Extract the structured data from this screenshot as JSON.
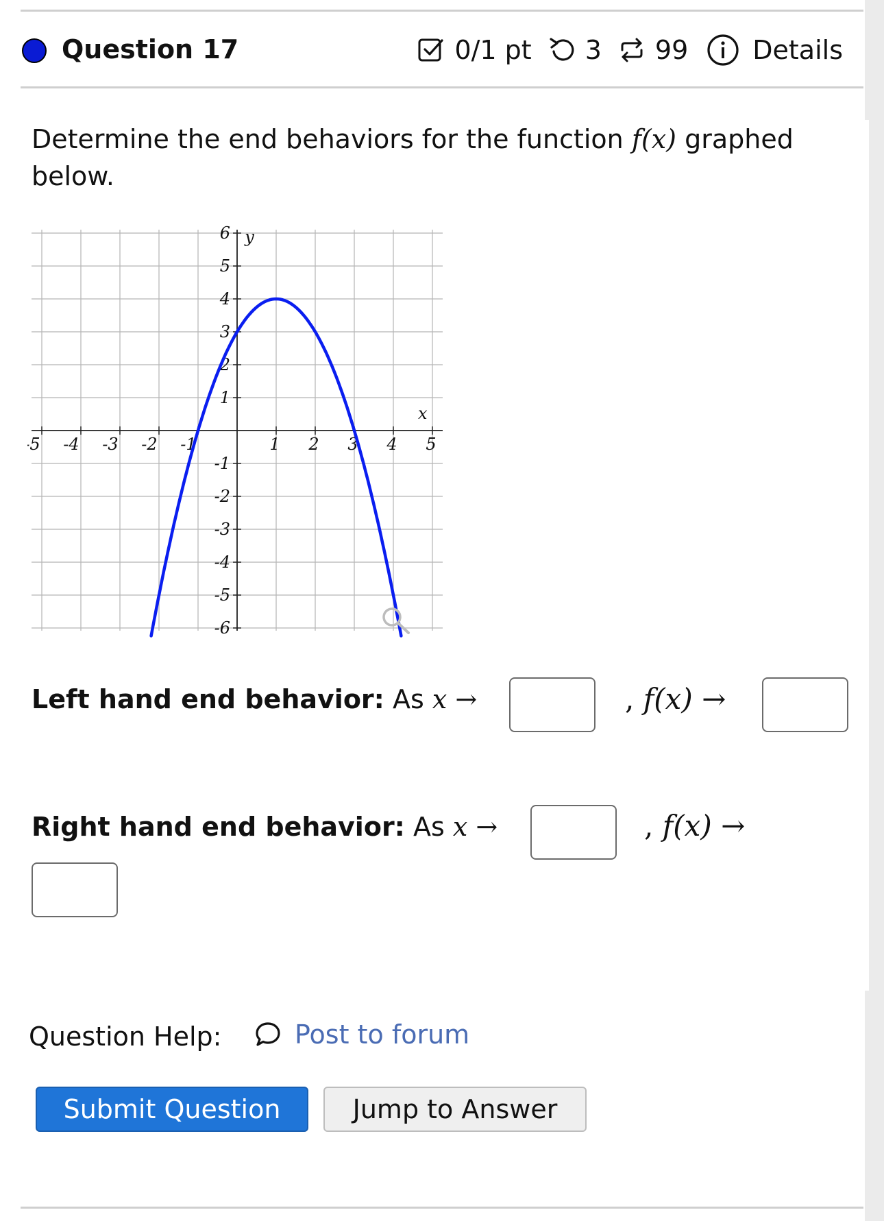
{
  "question": {
    "title": "Question 17",
    "score": "0/1 pt",
    "attempts": "3",
    "tries": "99",
    "details_label": "Details"
  },
  "prompt": {
    "text_before": "Determine the end behaviors for the function ",
    "func": "f(x)",
    "text_after": " graphed below."
  },
  "graph": {
    "x_axis_label": "x",
    "y_axis_label": "y",
    "x_ticks": [
      "-5",
      "-4",
      "-3",
      "-2",
      "-1",
      "1",
      "2",
      "3",
      "4",
      "5"
    ],
    "y_ticks": [
      "6",
      "5",
      "4",
      "3",
      "2",
      "1",
      "-1",
      "-2",
      "-3",
      "-4",
      "-5",
      "-6"
    ],
    "curve_color": "#0a1ef0",
    "magnify_icon": "magnifier-icon"
  },
  "chart_data": {
    "type": "line",
    "xlim": [
      -5,
      5
    ],
    "ylim": [
      -6,
      6
    ],
    "grid": true,
    "series": [
      {
        "x": [
          -2.2,
          -2.0,
          -1.5,
          -1.0,
          -0.5,
          0.0,
          0.5,
          1.0,
          1.5,
          2.0,
          2.5,
          3.0,
          3.5,
          4.0,
          4.2
        ],
        "y": [
          -6.24,
          -5.0,
          -2.25,
          0.0,
          1.75,
          3.0,
          3.75,
          4.0,
          3.75,
          3.0,
          1.75,
          0.0,
          -2.25,
          -5.0,
          -6.24
        ]
      }
    ]
  },
  "left_row": {
    "label": "Left hand end behavior:",
    "as_text": "As ",
    "x": "x",
    "arrow": "→",
    "comma": ",",
    "fx": "f(x)"
  },
  "right_row": {
    "label": "Right hand end behavior:",
    "as_text": "As ",
    "x": "x",
    "arrow": "→",
    "comma": ",",
    "fx": "f(x)"
  },
  "help": {
    "label": "Question Help:",
    "forum_link": "Post to forum"
  },
  "buttons": {
    "submit": "Submit Question",
    "jump": "Jump to Answer"
  },
  "colors": {
    "accent": "#1f75d8",
    "link": "#4a6cb4",
    "status_dot": "#0a1bd4"
  }
}
